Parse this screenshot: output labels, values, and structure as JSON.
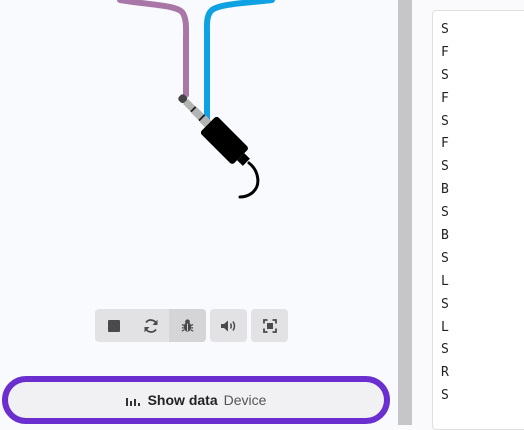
{
  "toolbar": {
    "buttons": [
      {
        "name": "stop-button",
        "icon": "stop-icon"
      },
      {
        "name": "restart-button",
        "icon": "restart-icon"
      },
      {
        "name": "debug-button",
        "icon": "bug-icon"
      },
      {
        "name": "mute-button",
        "icon": "speaker-icon"
      },
      {
        "name": "fullscreen-button",
        "icon": "fullscreen-icon"
      }
    ]
  },
  "show_data": {
    "label": "Show data",
    "sublabel": "Device",
    "icon": "bar-chart-icon"
  },
  "console": {
    "lines": [
      "S",
      "F",
      "S",
      "F",
      "S",
      "F",
      "S",
      "B",
      "S",
      "B",
      "S",
      "L",
      "S",
      "L",
      "S",
      "R",
      "S"
    ]
  },
  "colors": {
    "accent": "#6b2fcf",
    "wire_purple": "#a877a8",
    "wire_blue": "#0ea2e3",
    "jack": "#000000",
    "jack_metal": "#b3b3b3"
  }
}
